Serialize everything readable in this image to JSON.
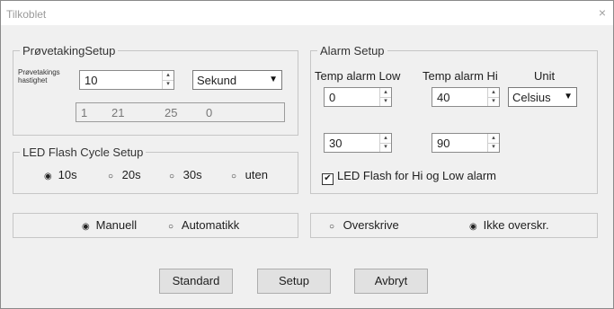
{
  "window": {
    "title": "Tilkoblet",
    "close_glyph": "×"
  },
  "sampling": {
    "title": "PrøvetakingSetup",
    "rate_label_line1": "Prøvetakings",
    "rate_label_line2": "hastighet",
    "rate_value": "10",
    "unit_selected": "Sekund",
    "readout": [
      "1",
      "21",
      "25",
      "0"
    ]
  },
  "led": {
    "title": "LED Flash Cycle Setup",
    "options": [
      "10s",
      "20s",
      "30s",
      "uten"
    ],
    "selected": "10s"
  },
  "mode": {
    "options": [
      "Manuell",
      "Automatikk"
    ],
    "selected": "Manuell"
  },
  "alarm": {
    "title": "Alarm Setup",
    "low_label": "Temp alarm Low",
    "hi_label": "Temp alarm Hi",
    "unit_label": "Unit",
    "low_value": "0",
    "hi_value": "40",
    "unit_selected": "Celsius",
    "low_value2": "30",
    "hi_value2": "90",
    "led_flash_label": "LED Flash for Hi og Low alarm",
    "led_flash_checked": true
  },
  "overwrite": {
    "options": [
      "Overskrive",
      "Ikke overskr."
    ],
    "selected": "Ikke overskr."
  },
  "buttons": {
    "standard": "Standard",
    "setup": "Setup",
    "abort": "Avbryt"
  },
  "glyphs": {
    "radio_on": "◉",
    "radio_off": "○",
    "check": "✔",
    "spin_up": "▴",
    "spin_down": "▾",
    "combo_arrow": "▼"
  }
}
